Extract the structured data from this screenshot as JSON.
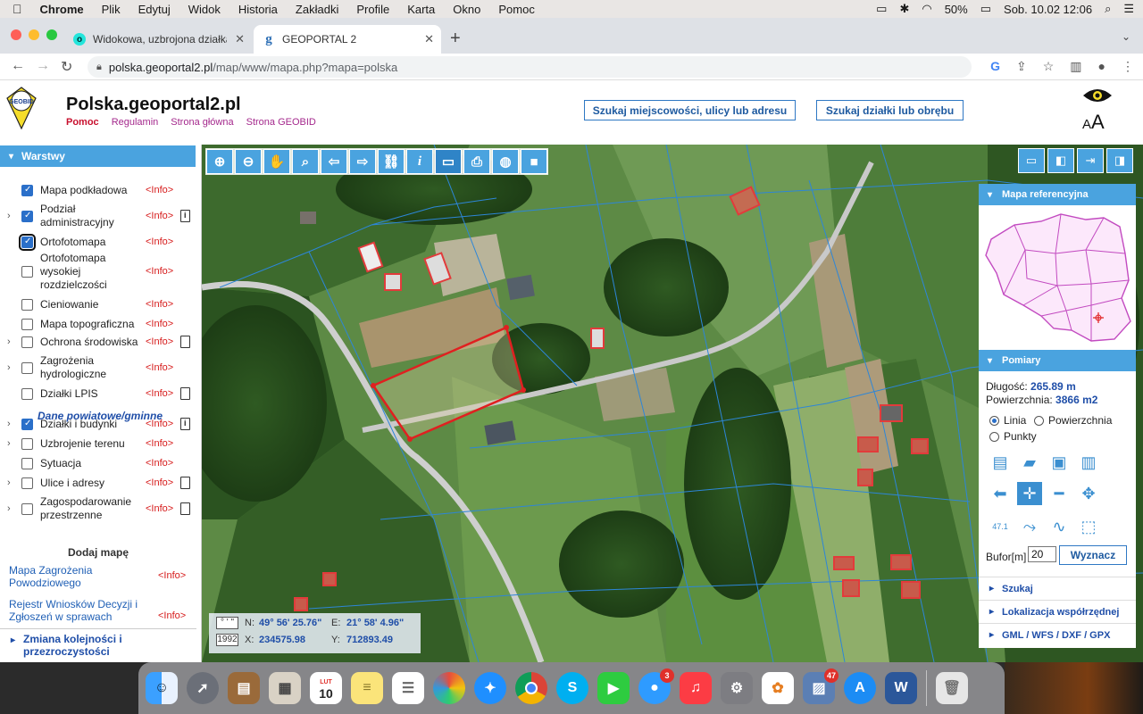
{
  "macos": {
    "menu": [
      "Chrome",
      "Plik",
      "Edytuj",
      "Widok",
      "Historia",
      "Zakładki",
      "Profile",
      "Karta",
      "Okno",
      "Pomoc"
    ],
    "battery": "50%",
    "clock": "Sob. 10.02  12:06"
  },
  "browser": {
    "tabs": [
      {
        "title": "Widokowa, uzbrojona działka z",
        "favicon": "olx-icon"
      },
      {
        "title": "GEOPORTAL 2",
        "favicon": "geoportal-g-icon"
      }
    ],
    "url_host": "polska.geoportal2.pl",
    "url_path": "/map/www/mapa.php?mapa=polska"
  },
  "header": {
    "logo_text": "GEOBID",
    "site_title": "Polska.geoportal2.pl",
    "links": [
      "Pomoc",
      "Regulamin",
      "Strona główna",
      "Strona GEOBID"
    ],
    "search_address": "Szukaj miejscowości, ulicy lub adresu",
    "search_parcel": "Szukaj działki lub obrębu",
    "font_toggle": "A",
    "font_toggle_big": "A"
  },
  "layers_panel": {
    "title": "Warstwy",
    "info_label": "<Info>",
    "layers": [
      {
        "label": "Mapa podkładowa",
        "checked": true
      },
      {
        "label": "Podział administracyjny",
        "checked": true,
        "expandable": true
      },
      {
        "label": "Ortofotomapa",
        "checked": true
      },
      {
        "label": "Ortofotomapa wysokiej rozdzielczości",
        "checked": false
      },
      {
        "label": "Cieniowanie",
        "checked": false
      },
      {
        "label": "Mapa topograficzna",
        "checked": false
      },
      {
        "label": "Ochrona środowiska",
        "checked": false,
        "expandable": true
      },
      {
        "label": "Zagrożenia hydrologiczne",
        "checked": false,
        "expandable": true
      },
      {
        "label": "Działki LPIS",
        "checked": false
      },
      {
        "label": "Działki i budynki",
        "checked": true,
        "expandable": true
      },
      {
        "label": "Uzbrojenie terenu",
        "checked": false,
        "expandable": true
      },
      {
        "label": "Sytuacja",
        "checked": false
      },
      {
        "label": "Ulice i adresy",
        "checked": false,
        "expandable": true
      },
      {
        "label": "Zagospodarowanie przestrzenne",
        "checked": false,
        "expandable": true
      }
    ],
    "section_heading": "Dane powiatowe/gminne",
    "add_map_title": "Dodaj mapę",
    "add_maps": [
      "Mapa Zagrożenia Powodziowego",
      "Rejestr Wniosków Decyzji i Zgłoszeń w sprawach"
    ],
    "order_label": "Zmiana kolejności i przezroczystości"
  },
  "coords": {
    "format_label": "° ' \"",
    "system": "1992",
    "n_label": "N:",
    "n_value": "49° 56' 25.76\"",
    "e_label": "E:",
    "e_value": "21° 58' 4.96\"",
    "x_label": "X:",
    "x_value": "234575.98",
    "y_label": "Y:",
    "y_value": "712893.49"
  },
  "right_panel": {
    "ref_title": "Mapa referencyjna",
    "pomiary_title": "Pomiary",
    "length_label": "Długość:",
    "length_value": "265.89 m",
    "area_label": "Powierzchnia:",
    "area_value": "3866 m2",
    "radio_linia": "Linia",
    "radio_powierzchnia": "Powierzchnia",
    "radio_punkty": "Punkty",
    "bufor_label": "Bufor[m]",
    "bufor_value": "20",
    "wyznacz": "Wyznacz",
    "point_label": "47.1",
    "sections": [
      "Szukaj",
      "Lokalizacja współrzędnej",
      "GML / WFS / DXF / GPX"
    ]
  },
  "dock": {
    "calendar_month": "LUT",
    "calendar_day": "10",
    "badges": {
      "messages": "3",
      "preview": "47"
    }
  }
}
